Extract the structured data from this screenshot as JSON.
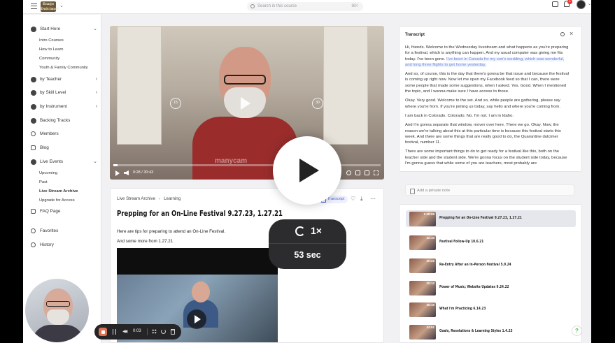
{
  "topbar": {
    "logo_text": "Banjo Dulcimer",
    "search_placeholder": "Search in this course",
    "search_shortcut": "⌘K",
    "notification_count": "1"
  },
  "sidebar": {
    "start_here": "Start Here",
    "start_here_items": [
      "Intro Courses",
      "How to Learn",
      "Community",
      "Youth & Family Community"
    ],
    "by_teacher": "by Teacher",
    "by_skill": "by Skill Level",
    "by_instrument": "by Instrument",
    "backing_tracks": "Backing Tracks",
    "members": "Members",
    "blog": "Blog",
    "live_events": "Live Events",
    "live_events_items": [
      "Upcoming",
      "Past",
      "Live Stream Archive",
      "Upgrade for Access"
    ],
    "faq": "FAQ Page",
    "favorites": "Favorites",
    "history": "History"
  },
  "video": {
    "skip_back": "15",
    "skip_fwd": "30",
    "current_time": "0:28",
    "duration": "30:43",
    "progress_fraction": 0.015,
    "watermark": "manycam"
  },
  "lesson": {
    "breadcrumb": [
      "Live Stream Archive",
      "Learning"
    ],
    "transcript_button": "Transcript",
    "title": "Prepping for an On-Line Festival 9.27.23, 1.27.21",
    "paragraphs": [
      "Here are tips for preparing to attend an On-Line Festival.",
      "And some more from 1.27.21"
    ]
  },
  "transcript": {
    "title": "Transcript",
    "para1_before": "Hi, friends.  Welcome to the Wednesday livestream and what happens as you're preparing for a festival, which is anything can happen.  And my usual computer was giving me fits today.  I've been gone.  ",
    "para1_highlight": "I've been in Canada for my son's wedding, which was wonderful, and long three flights to get home yesterday.",
    "paragraphs": [
      "And so, of course, this is the day that there's gonna be that issue and because the festival is coming up right now.  Now let me open my Facebook feed so that I can, there were some people that made some suggestions, when I asked.  Yes.  Good.  When I mentioned the topic, and I wanna make sure I have access to those.",
      "Okay.  Very good.  Welcome to the set.  And so, while people are gathering, please say where you're from.  If you're joining us today, say hello and where you're coming from.",
      "I am back in Colorado.  Colorado.  No.  I'm not.  I am in Idaho.",
      "And I'm gonna separate that window, mover over here.  There we go.  Okay.  Now, the reason we're talking about this at this particular time is because this festival starts this week.  And there are some things that are really good to do, the Quarantine dulcimer festival, number 11.",
      "There are some important things to do to get ready for a festival like this, both on the teacher side and the student side.  We're gonna focus on the student side today, because I'm gonna guess that while some of you are teachers, most probably are"
    ]
  },
  "private_note": {
    "placeholder": "Add a private note"
  },
  "playlist": [
    {
      "duration": "1:08:06",
      "title": "Prepping for an On-Line Festival 9.27.23, 1.27.21",
      "active": true
    },
    {
      "duration": "32:10",
      "title": "Festival Follow-Up 10.6.21",
      "active": false
    },
    {
      "duration": "30:22",
      "title": "Re-Entry After an In-Person Festival 5.9.24",
      "active": false
    },
    {
      "duration": "25:12",
      "title": "Power of Music; Website Updates 9.24.22",
      "active": false
    },
    {
      "duration": "35:15",
      "title": "What I'm Practicing 6.14.23",
      "active": false
    },
    {
      "duration": "34:51",
      "title": "Goals, Resolutions & Learning Styles 1.4.23",
      "active": false
    }
  ],
  "help": "?",
  "overlay": {
    "speed": "1×",
    "skip_amount": "53 sec"
  },
  "recorder": {
    "elapsed": "0:03"
  }
}
